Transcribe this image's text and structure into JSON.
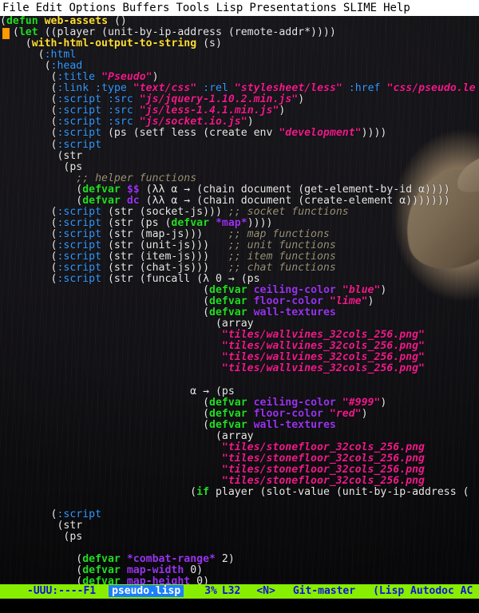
{
  "window": {
    "app": "GNU Emacs",
    "menu": [
      "File",
      "Edit",
      "Options",
      "Buffers",
      "Tools",
      "Lisp",
      "Presentations",
      "SLIME",
      "Help"
    ]
  },
  "modeline": {
    "left": "-UUU:----F1",
    "buffer_name": "pseudo.lisp",
    "position_percent": "3%",
    "line": "L32",
    "narrow": "<N>",
    "vc": "Git-master",
    "major_mode": "(Lisp Autodoc AC"
  },
  "echo": "",
  "colors": {
    "background": "#111015",
    "foreground": "#ffffff",
    "definition": "#22dd22",
    "function_name": "#ffdd33",
    "keyword": "#3399ff",
    "string": "#ee1a8a",
    "comment": "#9a9277",
    "variable": "#9933ee",
    "cursor": "#ff9900",
    "modeline_bg": "#88ee00",
    "modeline_fg": "#1111dd",
    "buffer_highlight_bg": "#1a7fff",
    "menubar_bg": "#ffffff",
    "menubar_fg": "#000000"
  },
  "code_lines": [
    [
      [
        "p",
        "("
      ],
      [
        "d",
        "defun"
      ],
      [
        "p",
        " "
      ],
      [
        "f",
        "web-assets"
      ],
      [
        "p",
        " ()"
      ]
    ],
    [
      [
        "p",
        "  ("
      ],
      [
        "d",
        "let"
      ],
      [
        "p",
        " ((player (unit-by-ip-address (remote-addr*))))"
      ]
    ],
    [
      [
        "p",
        "    ("
      ],
      [
        "f",
        "with-html-output-to-string"
      ],
      [
        "p",
        " (s)"
      ]
    ],
    [
      [
        "p",
        "      ("
      ],
      [
        "k",
        ":html"
      ]
    ],
    [
      [
        "p",
        "       ("
      ],
      [
        "k",
        ":head"
      ]
    ],
    [
      [
        "p",
        "        ("
      ],
      [
        "k",
        ":title"
      ],
      [
        "p",
        " "
      ],
      [
        "s",
        "\"Pseudo\""
      ],
      [
        "p",
        ")"
      ]
    ],
    [
      [
        "p",
        "        ("
      ],
      [
        "k",
        ":link"
      ],
      [
        "p",
        " "
      ],
      [
        "k",
        ":type"
      ],
      [
        "p",
        " "
      ],
      [
        "s",
        "\"text/css\""
      ],
      [
        "p",
        " "
      ],
      [
        "k",
        ":rel"
      ],
      [
        "p",
        " "
      ],
      [
        "s",
        "\"stylesheet/less\""
      ],
      [
        "p",
        " "
      ],
      [
        "k",
        ":href"
      ],
      [
        "p",
        " "
      ],
      [
        "s",
        "\"css/pseudo.le"
      ]
    ],
    [
      [
        "p",
        "        ("
      ],
      [
        "k",
        ":script"
      ],
      [
        "p",
        " "
      ],
      [
        "k",
        ":src"
      ],
      [
        "p",
        " "
      ],
      [
        "s",
        "\"js/jquery-1.10.2.min.js\""
      ],
      [
        "p",
        ")"
      ]
    ],
    [
      [
        "p",
        "        ("
      ],
      [
        "k",
        ":script"
      ],
      [
        "p",
        " "
      ],
      [
        "k",
        ":src"
      ],
      [
        "p",
        " "
      ],
      [
        "s",
        "\"js/less-1.4.1.min.js\""
      ],
      [
        "p",
        ")"
      ]
    ],
    [
      [
        "p",
        "        ("
      ],
      [
        "k",
        ":script"
      ],
      [
        "p",
        " "
      ],
      [
        "k",
        ":src"
      ],
      [
        "p",
        " "
      ],
      [
        "s",
        "\"js/socket.io.js\""
      ],
      [
        "p",
        ")"
      ]
    ],
    [
      [
        "p",
        "        ("
      ],
      [
        "k",
        ":script"
      ],
      [
        "p",
        " (ps (setf less (create env "
      ],
      [
        "s",
        "\"development\""
      ],
      [
        "p",
        "))))"
      ]
    ],
    [
      [
        "p",
        "        ("
      ],
      [
        "k",
        ":script"
      ]
    ],
    [
      [
        "p",
        "         (str"
      ],
      [
        "p",
        ""
      ]
    ],
    [
      [
        "p",
        "          (ps"
      ]
    ],
    [
      [
        "p",
        "            "
      ],
      [
        "c",
        ";; helper functions"
      ]
    ],
    [
      [
        "p",
        "            ("
      ],
      [
        "d",
        "defvar"
      ],
      [
        "p",
        " "
      ],
      [
        "v",
        "$$"
      ],
      [
        "p",
        " (λλ α → (chain document (get-element-by-id α))))"
      ]
    ],
    [
      [
        "p",
        "            ("
      ],
      [
        "d",
        "defvar"
      ],
      [
        "p",
        " "
      ],
      [
        "v",
        "dc"
      ],
      [
        "p",
        " (λλ α → (chain document (create-element α)))))))"
      ]
    ],
    [
      [
        "p",
        "        ("
      ],
      [
        "k",
        ":script"
      ],
      [
        "p",
        " (str (socket-js))) "
      ],
      [
        "c",
        ";; socket functions"
      ]
    ],
    [
      [
        "p",
        "        ("
      ],
      [
        "k",
        ":script"
      ],
      [
        "p",
        " (str (ps ("
      ],
      [
        "d",
        "defvar"
      ],
      [
        "p",
        " "
      ],
      [
        "v",
        "*map*"
      ],
      [
        "p",
        "))))"
      ]
    ],
    [
      [
        "p",
        "        ("
      ],
      [
        "k",
        ":script"
      ],
      [
        "p",
        " (str (map-js)))    "
      ],
      [
        "c",
        ";; map functions"
      ]
    ],
    [
      [
        "p",
        "        ("
      ],
      [
        "k",
        ":script"
      ],
      [
        "p",
        " (str (unit-js)))   "
      ],
      [
        "c",
        ";; unit functions"
      ]
    ],
    [
      [
        "p",
        "        ("
      ],
      [
        "k",
        ":script"
      ],
      [
        "p",
        " (str (item-js)))   "
      ],
      [
        "c",
        ";; item functions"
      ]
    ],
    [
      [
        "p",
        "        ("
      ],
      [
        "k",
        ":script"
      ],
      [
        "p",
        " (str (chat-js)))   "
      ],
      [
        "c",
        ";; chat functions"
      ]
    ],
    [
      [
        "p",
        "        ("
      ],
      [
        "k",
        ":script"
      ],
      [
        "p",
        " (str (funcall (λ 0 → (ps"
      ]
    ],
    [
      [
        "p",
        "                                ("
      ],
      [
        "d",
        "defvar"
      ],
      [
        "p",
        " "
      ],
      [
        "v",
        "ceiling-color"
      ],
      [
        "p",
        " "
      ],
      [
        "s",
        "\"blue\""
      ],
      [
        "p",
        ")"
      ]
    ],
    [
      [
        "p",
        "                                ("
      ],
      [
        "d",
        "defvar"
      ],
      [
        "p",
        " "
      ],
      [
        "v",
        "floor-color"
      ],
      [
        "p",
        " "
      ],
      [
        "s",
        "\"lime\""
      ],
      [
        "p",
        ")"
      ]
    ],
    [
      [
        "p",
        "                                ("
      ],
      [
        "d",
        "defvar"
      ],
      [
        "p",
        " "
      ],
      [
        "v",
        "wall-textures"
      ]
    ],
    [
      [
        "p",
        "                                  (array"
      ]
    ],
    [
      [
        "p",
        "                                   "
      ],
      [
        "s",
        "\"tiles/wallvines_32cols_256.png\""
      ]
    ],
    [
      [
        "p",
        "                                   "
      ],
      [
        "s",
        "\"tiles/wallvines_32cols_256.png\""
      ]
    ],
    [
      [
        "p",
        "                                   "
      ],
      [
        "s",
        "\"tiles/wallvines_32cols_256.png\""
      ]
    ],
    [
      [
        "p",
        "                                   "
      ],
      [
        "s",
        "\"tiles/wallvines_32cols_256.png\""
      ]
    ],
    [
      [
        "p",
        ""
      ]
    ],
    [
      [
        "p",
        "                              α → (ps"
      ]
    ],
    [
      [
        "p",
        "                                ("
      ],
      [
        "d",
        "defvar"
      ],
      [
        "p",
        " "
      ],
      [
        "v",
        "ceiling-color"
      ],
      [
        "p",
        " "
      ],
      [
        "s",
        "\"#999\""
      ],
      [
        "p",
        ")"
      ]
    ],
    [
      [
        "p",
        "                                ("
      ],
      [
        "d",
        "defvar"
      ],
      [
        "p",
        " "
      ],
      [
        "v",
        "floor-color"
      ],
      [
        "p",
        " "
      ],
      [
        "s",
        "\"red\""
      ],
      [
        "p",
        ")"
      ]
    ],
    [
      [
        "p",
        "                                ("
      ],
      [
        "d",
        "defvar"
      ],
      [
        "p",
        " "
      ],
      [
        "v",
        "wall-textures"
      ]
    ],
    [
      [
        "p",
        "                                  (array"
      ]
    ],
    [
      [
        "p",
        "                                   "
      ],
      [
        "s",
        "\"tiles/stonefloor_32cols_256.png"
      ]
    ],
    [
      [
        "p",
        "                                   "
      ],
      [
        "s",
        "\"tiles/stonefloor_32cols_256.png"
      ]
    ],
    [
      [
        "p",
        "                                   "
      ],
      [
        "s",
        "\"tiles/stonefloor_32cols_256.png"
      ]
    ],
    [
      [
        "p",
        "                                   "
      ],
      [
        "s",
        "\"tiles/stonefloor_32cols_256.png"
      ]
    ],
    [
      [
        "p",
        "                              ("
      ],
      [
        "d",
        "if"
      ],
      [
        "p",
        " player (slot-value (unit-by-ip-address ("
      ]
    ],
    [
      [
        "p",
        ""
      ]
    ],
    [
      [
        "p",
        "        ("
      ],
      [
        "k",
        ":script"
      ]
    ],
    [
      [
        "p",
        "         (str"
      ]
    ],
    [
      [
        "p",
        "          (ps"
      ]
    ],
    [
      [
        "p",
        ""
      ]
    ],
    [
      [
        "p",
        "            ("
      ],
      [
        "d",
        "defvar"
      ],
      [
        "p",
        " "
      ],
      [
        "v",
        "*combat-range*"
      ],
      [
        "p",
        " 2)"
      ]
    ],
    [
      [
        "p",
        "            ("
      ],
      [
        "d",
        "defvar"
      ],
      [
        "p",
        " "
      ],
      [
        "v",
        "map-width"
      ],
      [
        "p",
        " 0)"
      ]
    ],
    [
      [
        "p",
        "            ("
      ],
      [
        "d",
        "defvar"
      ],
      [
        "p",
        " "
      ],
      [
        "v",
        "map-height"
      ],
      [
        "p",
        " 0)"
      ]
    ]
  ]
}
